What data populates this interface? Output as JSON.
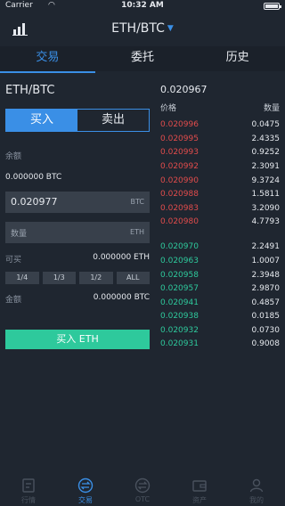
{
  "status": {
    "carrier": "Carrier",
    "time": "10:32 AM"
  },
  "nav": {
    "title": "ETH/BTC"
  },
  "tabs": [
    {
      "label": "交易"
    },
    {
      "label": "委托"
    },
    {
      "label": "历史"
    }
  ],
  "trade": {
    "pair": "ETH/BTC",
    "buy_label": "买入",
    "sell_label": "卖出",
    "balance_label": "余额",
    "balance_value": "0.000000 BTC",
    "price_value": "0.020977",
    "price_unit": "BTC",
    "amount_placeholder": "数量",
    "amount_unit": "ETH",
    "available_label": "可买",
    "available_value": "0.000000 ETH",
    "percents": [
      "1/4",
      "1/3",
      "1/2",
      "ALL"
    ],
    "total_label": "金额",
    "total_value": "0.000000 BTC",
    "submit_label": "买入 ETH"
  },
  "orderbook": {
    "last_price": "0.020967",
    "price_header": "价格",
    "qty_header": "数量",
    "asks": [
      {
        "price": "0.020996",
        "qty": "0.0475"
      },
      {
        "price": "0.020995",
        "qty": "2.4335"
      },
      {
        "price": "0.020993",
        "qty": "0.9252"
      },
      {
        "price": "0.020992",
        "qty": "2.3091"
      },
      {
        "price": "0.020990",
        "qty": "9.3724"
      },
      {
        "price": "0.020988",
        "qty": "1.5811"
      },
      {
        "price": "0.020983",
        "qty": "3.2090"
      },
      {
        "price": "0.020980",
        "qty": "4.7793"
      }
    ],
    "bids": [
      {
        "price": "0.020970",
        "qty": "2.2491"
      },
      {
        "price": "0.020963",
        "qty": "1.0007"
      },
      {
        "price": "0.020958",
        "qty": "2.3948"
      },
      {
        "price": "0.020957",
        "qty": "2.9870"
      },
      {
        "price": "0.020941",
        "qty": "0.4857"
      },
      {
        "price": "0.020938",
        "qty": "0.0185"
      },
      {
        "price": "0.020932",
        "qty": "0.0730"
      },
      {
        "price": "0.020931",
        "qty": "0.9008"
      }
    ]
  },
  "bottom_nav": [
    {
      "label": "行情",
      "icon": "market-icon"
    },
    {
      "label": "交易",
      "icon": "exchange-icon"
    },
    {
      "label": "OTC",
      "icon": "otc-icon"
    },
    {
      "label": "资产",
      "icon": "wallet-icon"
    },
    {
      "label": "我的",
      "icon": "profile-icon"
    }
  ],
  "colors": {
    "accent": "#3a8fe6",
    "ask": "#e14c4c",
    "bid": "#2ec99c",
    "background": "#1f2630"
  }
}
